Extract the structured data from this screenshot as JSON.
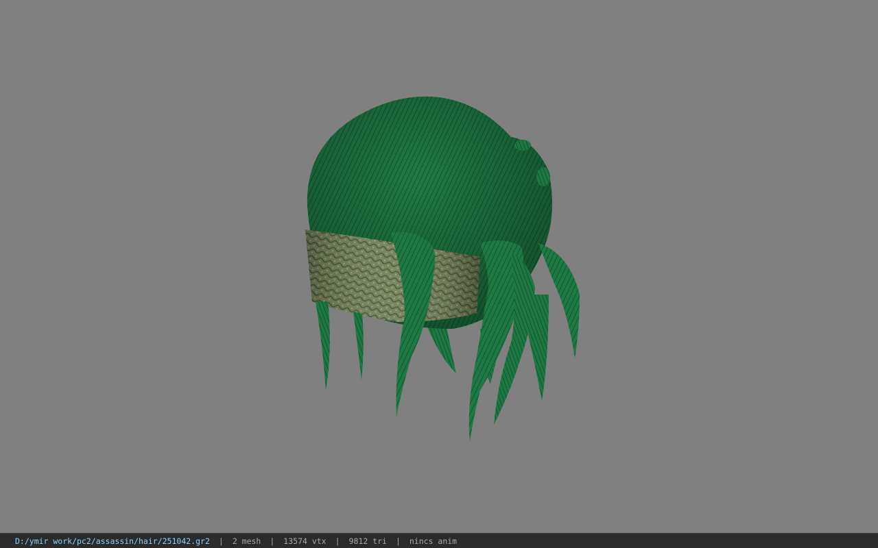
{
  "viewer": {
    "background_color": "#808080",
    "model": {
      "subject": "assassin hair model",
      "hair_color": "#1e7a45",
      "hair_dark_color": "#0d3a1f",
      "band_color": "#6f7d55",
      "band_light_color": "#a9b081"
    }
  },
  "status_bar": {
    "file_path": "D:/ymir work/pc2/assassin/hair/251042.gr2",
    "separator": "|",
    "mesh_count": "2 mesh",
    "vertex_count": "13574 vtx",
    "triangle_count": "9812 tri",
    "anim_info": "nincs anim",
    "background_color": "#2b2b2b",
    "path_color": "#8fd0ff"
  }
}
